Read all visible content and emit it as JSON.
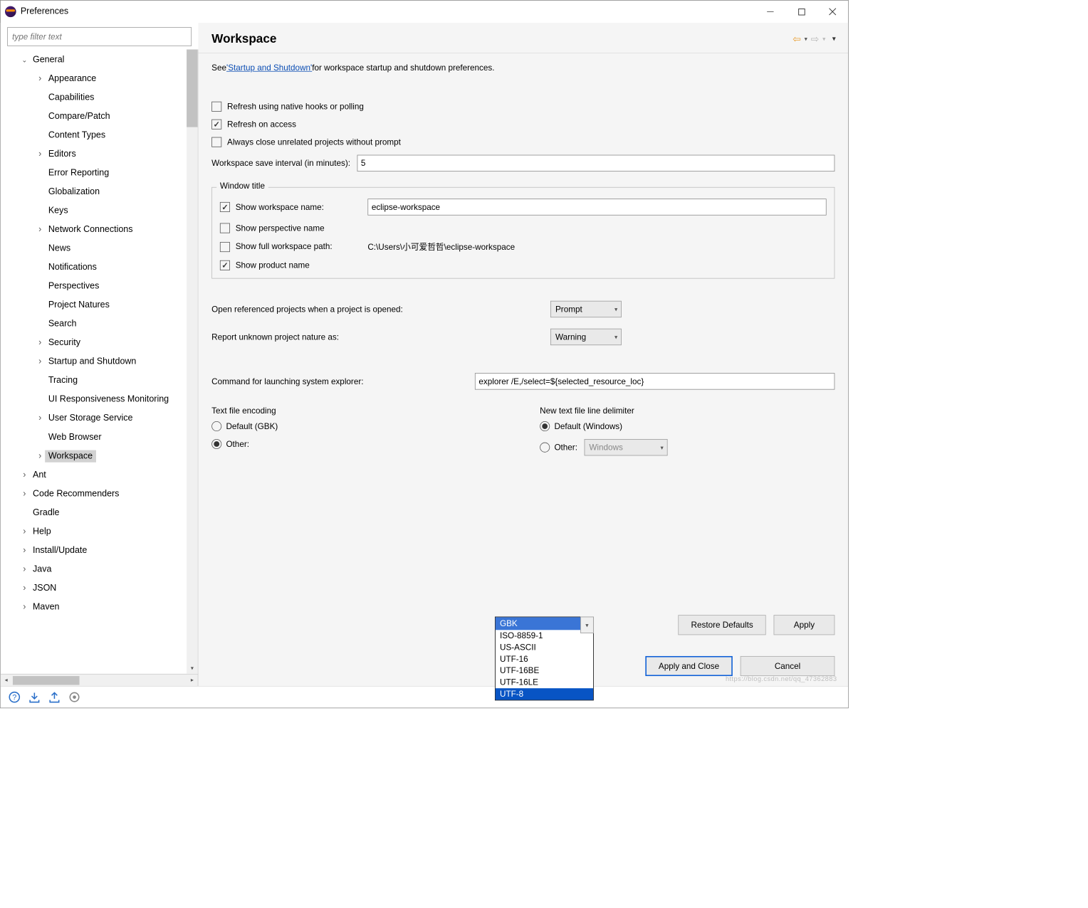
{
  "window": {
    "title": "Preferences"
  },
  "filter": {
    "placeholder": "type filter text"
  },
  "tree": [
    {
      "label": "General",
      "indent": 1,
      "arrow": "down"
    },
    {
      "label": "Appearance",
      "indent": 2,
      "arrow": "right"
    },
    {
      "label": "Capabilities",
      "indent": 2,
      "arrow": ""
    },
    {
      "label": "Compare/Patch",
      "indent": 2,
      "arrow": ""
    },
    {
      "label": "Content Types",
      "indent": 2,
      "arrow": ""
    },
    {
      "label": "Editors",
      "indent": 2,
      "arrow": "right"
    },
    {
      "label": "Error Reporting",
      "indent": 2,
      "arrow": ""
    },
    {
      "label": "Globalization",
      "indent": 2,
      "arrow": ""
    },
    {
      "label": "Keys",
      "indent": 2,
      "arrow": ""
    },
    {
      "label": "Network Connections",
      "indent": 2,
      "arrow": "right"
    },
    {
      "label": "News",
      "indent": 2,
      "arrow": ""
    },
    {
      "label": "Notifications",
      "indent": 2,
      "arrow": ""
    },
    {
      "label": "Perspectives",
      "indent": 2,
      "arrow": ""
    },
    {
      "label": "Project Natures",
      "indent": 2,
      "arrow": ""
    },
    {
      "label": "Search",
      "indent": 2,
      "arrow": ""
    },
    {
      "label": "Security",
      "indent": 2,
      "arrow": "right"
    },
    {
      "label": "Startup and Shutdown",
      "indent": 2,
      "arrow": "right"
    },
    {
      "label": "Tracing",
      "indent": 2,
      "arrow": ""
    },
    {
      "label": "UI Responsiveness Monitoring",
      "indent": 2,
      "arrow": ""
    },
    {
      "label": "User Storage Service",
      "indent": 2,
      "arrow": "right"
    },
    {
      "label": "Web Browser",
      "indent": 2,
      "arrow": ""
    },
    {
      "label": "Workspace",
      "indent": 2,
      "arrow": "right",
      "selected": true
    },
    {
      "label": "Ant",
      "indent": 1,
      "arrow": "right"
    },
    {
      "label": "Code Recommenders",
      "indent": 1,
      "arrow": "right"
    },
    {
      "label": "Gradle",
      "indent": 1,
      "arrow": ""
    },
    {
      "label": "Help",
      "indent": 1,
      "arrow": "right"
    },
    {
      "label": "Install/Update",
      "indent": 1,
      "arrow": "right"
    },
    {
      "label": "Java",
      "indent": 1,
      "arrow": "right"
    },
    {
      "label": "JSON",
      "indent": 1,
      "arrow": "right"
    },
    {
      "label": "Maven",
      "indent": 1,
      "arrow": "right"
    }
  ],
  "page": {
    "title": "Workspace",
    "intro_prefix": "See ",
    "intro_link": "'Startup and Shutdown'",
    "intro_suffix": " for workspace startup and shutdown preferences.",
    "refresh_native": "Refresh using native hooks or polling",
    "refresh_access": "Refresh on access",
    "close_unrelated": "Always close unrelated projects without prompt",
    "save_interval_label": "Workspace save interval (in minutes):",
    "save_interval_value": "5",
    "window_title_legend": "Window title",
    "show_ws_name": "Show workspace name:",
    "ws_name_value": "eclipse-workspace",
    "show_perspective": "Show perspective name",
    "show_full_path": "Show full workspace path:",
    "full_path_value": "C:\\Users\\小可爱哲哲\\eclipse-workspace",
    "show_product": "Show product name",
    "open_ref_label": "Open referenced projects when a project is opened:",
    "open_ref_value": "Prompt",
    "report_nature_label": "Report unknown project nature as:",
    "report_nature_value": "Warning",
    "cmd_explorer_label": "Command for launching system explorer:",
    "cmd_explorer_value": "explorer /E,/select=${selected_resource_loc}",
    "encoding_legend": "Text file encoding",
    "encoding_default": "Default (GBK)",
    "encoding_other": "Other:",
    "encoding_other_value": "GBK",
    "encoding_options": [
      "ISO-8859-1",
      "US-ASCII",
      "UTF-16",
      "UTF-16BE",
      "UTF-16LE",
      "UTF-8"
    ],
    "delimiter_legend": "New text file line delimiter",
    "delimiter_default": "Default (Windows)",
    "delimiter_other": "Other:",
    "delimiter_other_value": "Windows",
    "restore_defaults": "Restore Defaults",
    "apply": "Apply",
    "apply_close": "Apply and Close",
    "cancel": "Cancel"
  },
  "watermark": "https://blog.csdn.net/qq_47362883"
}
